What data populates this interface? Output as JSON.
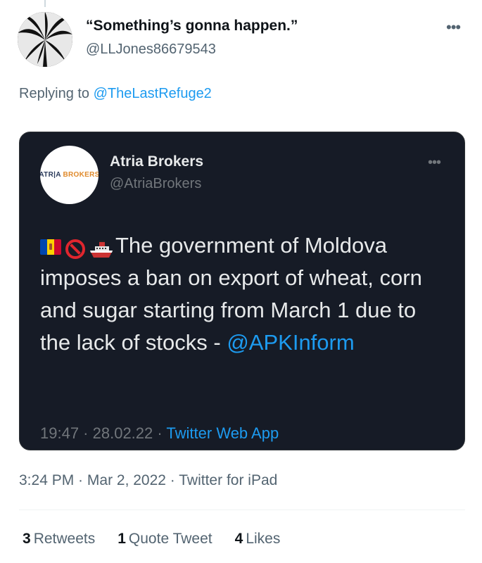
{
  "tweet": {
    "author_name": "“Something’s gonna happen.”",
    "author_handle": "@LLJones86679543",
    "more_icon": "more-horizontal-icon",
    "replying_prefix": "Replying to",
    "replying_to": "@TheLastRefuge2",
    "time": "3:24 PM",
    "date": "Mar 2, 2022",
    "source": "Twitter for iPad"
  },
  "quoted": {
    "author_name": "Atria Brokers",
    "author_handle": "@AtriaBrokers",
    "logo_text_a": "ATR",
    "logo_text_b": "A",
    "logo_text_c": "BROKERS",
    "text": "The government of Moldova imposes a ban on export of wheat, corn and sugar starting from March 1 due to the lack of stocks - ",
    "link": "@APKInform",
    "time": "19:47",
    "date": "28.02.22",
    "source": "Twitter Web App",
    "emojis": [
      "moldova-flag-icon",
      "no-entry-icon",
      "ship-icon"
    ],
    "colors": {
      "background": "#161b26",
      "link": "#1d9bf0"
    }
  },
  "stats": {
    "retweets_count": "3",
    "retweets_label": "Retweets",
    "quotes_count": "1",
    "quotes_label": "Quote Tweet",
    "likes_count": "4",
    "likes_label": "Likes"
  }
}
